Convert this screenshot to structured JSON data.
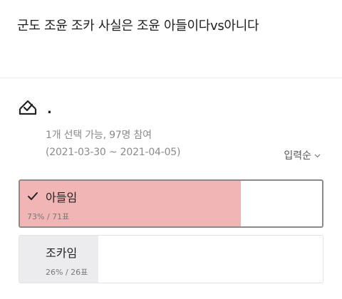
{
  "post": {
    "title": "군도 조윤 조카 사실은 조윤 아들이다vs아니다"
  },
  "vote": {
    "icon": "vote-box-icon",
    "name": ".",
    "meta": "1개 선택 가능, 97명 참여",
    "period": "(2021-03-30 ~ 2021-04-05)",
    "sort": {
      "selected": "입력순",
      "icon": "chevron-down-icon"
    },
    "options": [
      {
        "label": "아들임",
        "stats": "73% / 71표",
        "percent": 73,
        "selected": true,
        "fill_color": "#f2b5b6"
      },
      {
        "label": "조카임",
        "stats": "26% / 26표",
        "percent": 26,
        "selected": false,
        "fill_color": "#ececee"
      }
    ]
  }
}
